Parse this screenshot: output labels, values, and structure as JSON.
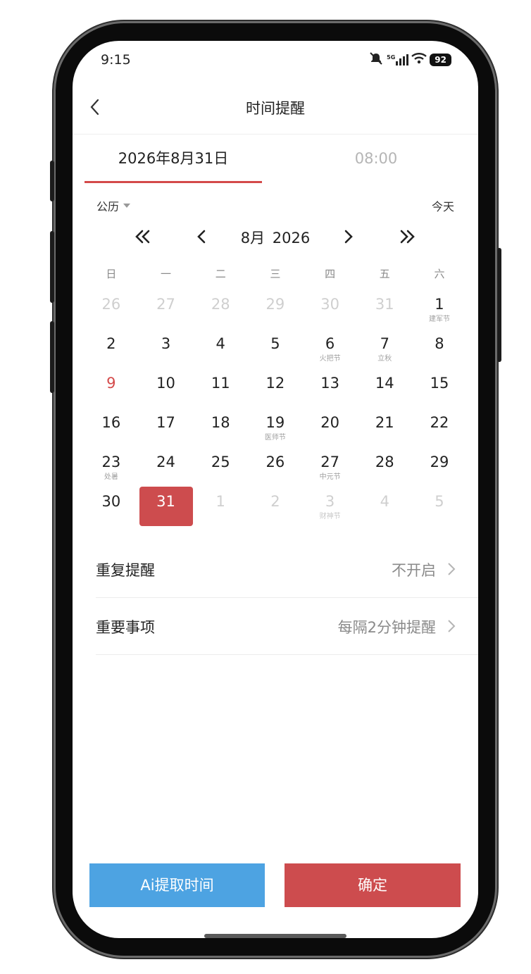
{
  "status_bar": {
    "time": "9:15",
    "network": "5G",
    "battery": "92",
    "icons": [
      "mute-icon",
      "signal-icon",
      "wifi-icon",
      "battery-icon"
    ]
  },
  "nav": {
    "title": "时间提醒",
    "back_icon": "chevron-left-icon"
  },
  "tabs": {
    "date": "2026年8月31日",
    "time": "08:00",
    "active": "date"
  },
  "calendar": {
    "mode": "公历",
    "today": "今天",
    "month_label": "8月  2026",
    "weekdays": [
      "日",
      "一",
      "二",
      "三",
      "四",
      "五",
      "六"
    ],
    "days": [
      {
        "d": "26",
        "sub": "",
        "other": true
      },
      {
        "d": "27",
        "sub": "",
        "other": true
      },
      {
        "d": "28",
        "sub": "",
        "other": true
      },
      {
        "d": "29",
        "sub": "",
        "other": true
      },
      {
        "d": "30",
        "sub": "",
        "other": true
      },
      {
        "d": "31",
        "sub": "",
        "other": true
      },
      {
        "d": "1",
        "sub": "建军节"
      },
      {
        "d": "2",
        "sub": ""
      },
      {
        "d": "3",
        "sub": ""
      },
      {
        "d": "4",
        "sub": ""
      },
      {
        "d": "5",
        "sub": ""
      },
      {
        "d": "6",
        "sub": "火把节"
      },
      {
        "d": "7",
        "sub": "立秋"
      },
      {
        "d": "8",
        "sub": ""
      },
      {
        "d": "9",
        "sub": "",
        "red": true
      },
      {
        "d": "10",
        "sub": ""
      },
      {
        "d": "11",
        "sub": ""
      },
      {
        "d": "12",
        "sub": ""
      },
      {
        "d": "13",
        "sub": ""
      },
      {
        "d": "14",
        "sub": ""
      },
      {
        "d": "15",
        "sub": ""
      },
      {
        "d": "16",
        "sub": ""
      },
      {
        "d": "17",
        "sub": ""
      },
      {
        "d": "18",
        "sub": ""
      },
      {
        "d": "19",
        "sub": "医师节"
      },
      {
        "d": "20",
        "sub": ""
      },
      {
        "d": "21",
        "sub": ""
      },
      {
        "d": "22",
        "sub": ""
      },
      {
        "d": "23",
        "sub": "处暑"
      },
      {
        "d": "24",
        "sub": ""
      },
      {
        "d": "25",
        "sub": ""
      },
      {
        "d": "26",
        "sub": ""
      },
      {
        "d": "27",
        "sub": "中元节"
      },
      {
        "d": "28",
        "sub": ""
      },
      {
        "d": "29",
        "sub": ""
      },
      {
        "d": "30",
        "sub": ""
      },
      {
        "d": "31",
        "sub": "",
        "selected": true
      },
      {
        "d": "1",
        "sub": "",
        "other": true
      },
      {
        "d": "2",
        "sub": "",
        "other": true
      },
      {
        "d": "3",
        "sub": "财神节",
        "other": true
      },
      {
        "d": "4",
        "sub": "",
        "other": true
      },
      {
        "d": "5",
        "sub": "",
        "other": true
      }
    ]
  },
  "settings": [
    {
      "label": "重复提醒",
      "value": "不开启"
    },
    {
      "label": "重要事项",
      "value": "每隔2分钟提醒"
    }
  ],
  "buttons": {
    "ai": "Ai提取时间",
    "confirm": "确定"
  },
  "colors": {
    "accent_red": "#cd4c4e",
    "ai_blue": "#4da3e2",
    "muted": "#8a8a8a",
    "other_month": "#cfcfcf"
  }
}
